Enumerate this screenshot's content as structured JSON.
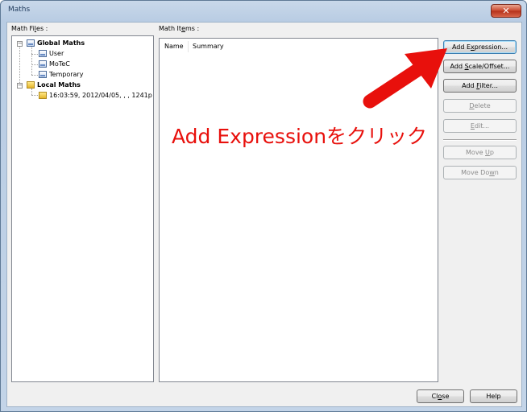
{
  "window": {
    "title": "Maths"
  },
  "labels": {
    "math_files_pre": "Math Fi",
    "math_files_key": "l",
    "math_files_post": "es :",
    "math_items_pre": "Math It",
    "math_items_key": "e",
    "math_items_post": "ms :"
  },
  "tree": {
    "global": {
      "label": "Global Maths",
      "children": [
        "User",
        "MoTeC",
        "Temporary"
      ]
    },
    "local": {
      "label": "Local Maths",
      "children": [
        "16:03:59, 2012/04/05, , , 1241p"
      ]
    }
  },
  "table": {
    "columns": [
      "Name",
      "Summary"
    ]
  },
  "buttons": {
    "add_expression": {
      "pre": "Add E",
      "key": "x",
      "post": "pression..."
    },
    "add_scale_offset": {
      "pre": "Add ",
      "key": "S",
      "post": "cale/Offset..."
    },
    "add_filter": {
      "pre": "Add ",
      "key": "F",
      "post": "ilter..."
    },
    "delete": {
      "pre": "",
      "key": "D",
      "post": "elete"
    },
    "edit": {
      "pre": "",
      "key": "E",
      "post": "dit..."
    },
    "move_up": {
      "pre": "Move ",
      "key": "U",
      "post": "p"
    },
    "move_down": {
      "pre": "Move Do",
      "key": "w",
      "post": "n"
    },
    "close": {
      "pre": "Cl",
      "key": "o",
      "post": "se"
    },
    "help": {
      "pre": "Help",
      "key": "",
      "post": ""
    }
  },
  "annotation": {
    "text": "Add Expressionをクリック",
    "color": "#e8100c"
  },
  "icons": {
    "close": "close-icon",
    "arrow": "red-arrow-icon"
  }
}
